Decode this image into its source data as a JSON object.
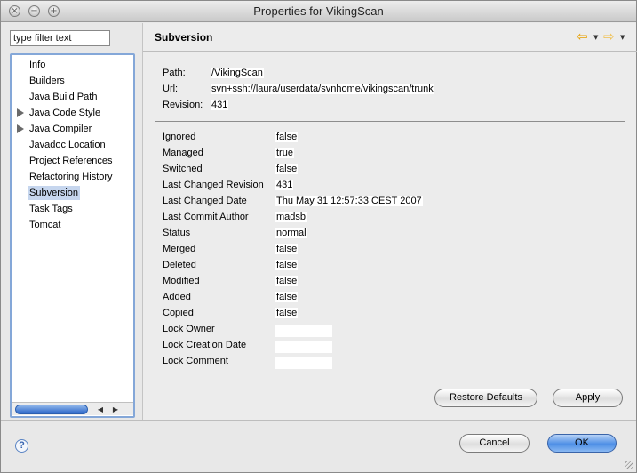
{
  "window": {
    "title": "Properties for VikingScan"
  },
  "sidebar": {
    "filter_placeholder": "type filter text",
    "items": [
      {
        "label": "Info",
        "expandable": false,
        "selected": false
      },
      {
        "label": "Builders",
        "expandable": false,
        "selected": false
      },
      {
        "label": "Java Build Path",
        "expandable": false,
        "selected": false
      },
      {
        "label": "Java Code Style",
        "expandable": true,
        "selected": false
      },
      {
        "label": "Java Compiler",
        "expandable": true,
        "selected": false
      },
      {
        "label": "Javadoc Location",
        "expandable": false,
        "selected": false
      },
      {
        "label": "Project References",
        "expandable": false,
        "selected": false
      },
      {
        "label": "Refactoring History",
        "expandable": false,
        "selected": false
      },
      {
        "label": "Subversion",
        "expandable": false,
        "selected": true
      },
      {
        "label": "Task Tags",
        "expandable": false,
        "selected": false
      },
      {
        "label": "Tomcat",
        "expandable": false,
        "selected": false
      }
    ]
  },
  "page": {
    "title": "Subversion",
    "summary": [
      {
        "label": "Path:",
        "value": "/VikingScan"
      },
      {
        "label": "Url:",
        "value": "svn+ssh://laura/userdata/svnhome/vikingscan/trunk"
      },
      {
        "label": "Revision:",
        "value": "431"
      }
    ],
    "properties": [
      {
        "label": "Ignored",
        "value": "false"
      },
      {
        "label": "Managed",
        "value": "true"
      },
      {
        "label": "Switched",
        "value": "false"
      },
      {
        "label": "Last Changed Revision",
        "value": "431"
      },
      {
        "label": "Last Changed Date",
        "value": "Thu May 31 12:57:33 CEST 2007"
      },
      {
        "label": "Last Commit Author",
        "value": "madsb"
      },
      {
        "label": "Status",
        "value": "normal"
      },
      {
        "label": "Merged",
        "value": "false"
      },
      {
        "label": "Deleted",
        "value": "false"
      },
      {
        "label": "Modified",
        "value": "false"
      },
      {
        "label": "Added",
        "value": "false"
      },
      {
        "label": "Copied",
        "value": "false"
      },
      {
        "label": "Lock Owner",
        "value": ""
      },
      {
        "label": "Lock Creation Date",
        "value": ""
      },
      {
        "label": "Lock Comment",
        "value": ""
      }
    ],
    "restore_defaults_label": "Restore Defaults",
    "apply_label": "Apply"
  },
  "footer": {
    "help_label": "?",
    "cancel_label": "Cancel",
    "ok_label": "OK"
  },
  "colors": {
    "selection": "#c6d6ee",
    "primary_button": "#4e8fe6",
    "nav_arrow": "#e8a000"
  },
  "icons": [
    "close-icon",
    "minimize-icon",
    "zoom-icon",
    "expand-arrow-icon",
    "back-arrow-icon",
    "forward-arrow-icon",
    "dropdown-icon",
    "help-icon",
    "resize-grip-icon"
  ]
}
